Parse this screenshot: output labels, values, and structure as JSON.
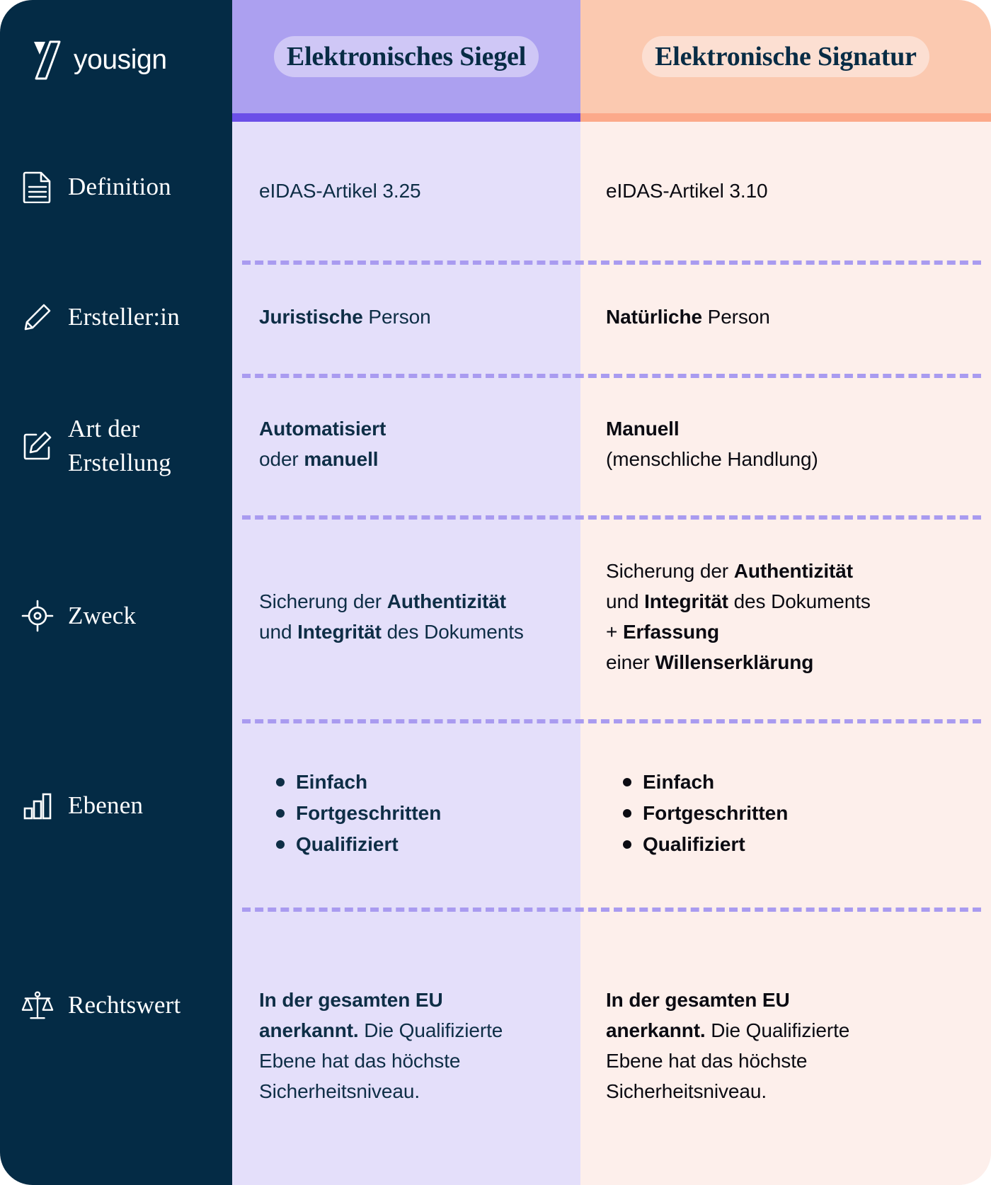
{
  "brand": {
    "name": "yousign",
    "logo_icon": "yousign-logo-icon"
  },
  "columns": {
    "seal": {
      "title": "Elektronisches Siegel",
      "header_bg": "#ACA0F0",
      "accent": "#6B4FE8",
      "body_bg": "#E4DFFA"
    },
    "sign": {
      "title": "Elektronische Signatur",
      "header_bg": "#FBC9B0",
      "accent": "#FCA98A",
      "body_bg": "#FDEFEB"
    }
  },
  "sidebar": {
    "bg": "#042B45",
    "rows": [
      {
        "label": "Definition",
        "icon": "document-icon"
      },
      {
        "label": "Ersteller:in",
        "icon": "pen-icon"
      },
      {
        "label": "Art der Erstellung",
        "icon": "pen-square-icon"
      },
      {
        "label": "Zweck",
        "icon": "target-icon"
      },
      {
        "label": "Ebenen",
        "icon": "bar-chart-icon"
      },
      {
        "label": "Rechtswert",
        "icon": "scales-icon"
      }
    ]
  },
  "rows": {
    "definition": {
      "seal": "eIDAS-Artikel 3.25",
      "sign": "eIDAS-Artikel 3.10"
    },
    "creator": {
      "seal_bold": "Juristische",
      "seal_rest": " Person",
      "sign_bold": "Natürliche",
      "sign_rest": " Person"
    },
    "creation_type": {
      "seal_l1_bold": "Automatisiert",
      "seal_l2_pre": "oder ",
      "seal_l2_bold": "manuell",
      "sign_l1_bold": "Manuell",
      "sign_l2": "(menschliche Handlung)"
    },
    "purpose": {
      "seal_l1_pre": "Sicherung der ",
      "seal_l1_bold": "Authentizität",
      "seal_l2_pre": "und ",
      "seal_l2_bold": "Integrität",
      "seal_l2_post": " des Dokuments",
      "sign_l1_pre": "Sicherung der ",
      "sign_l1_bold": "Authentizität",
      "sign_l2_pre": "und ",
      "sign_l2_bold": "Integrität",
      "sign_l2_post": " des Dokuments",
      "sign_l3_pre": "+ ",
      "sign_l3_bold": "Erfassung",
      "sign_l4_pre": "einer ",
      "sign_l4_bold": "Willenserklärung"
    },
    "levels": {
      "seal": [
        "Einfach",
        "Fortgeschritten",
        "Qualifiziert"
      ],
      "sign": [
        "Einfach",
        "Fortgeschritten",
        "Qualifiziert"
      ]
    },
    "legal_value": {
      "seal_bold": "In der gesamten EU anerkannt.",
      "seal_rest": " Die Qualifizierte Ebene hat das höchste Sicherheitsniveau.",
      "sign_bold": "In der gesamten EU anerkannt.",
      "sign_rest": " Die Qualifizierte Ebene hat das höchste Sicherheitsniveau."
    }
  }
}
